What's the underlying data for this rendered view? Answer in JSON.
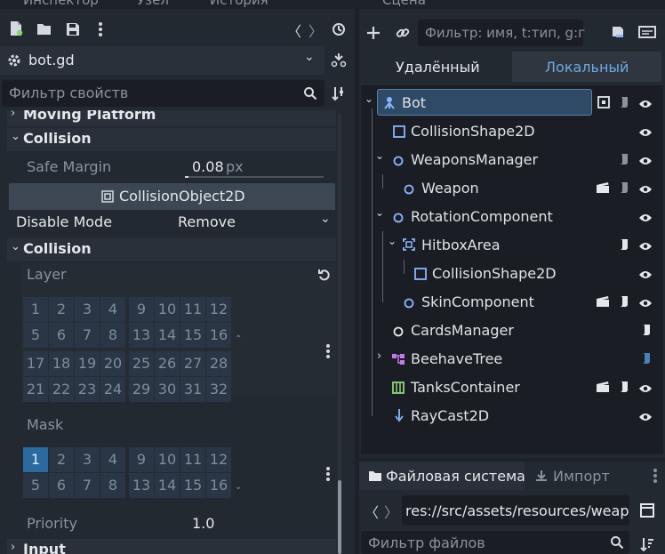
{
  "inspector": {
    "tabs": [
      "Инспектор",
      "Узел",
      "История"
    ],
    "script_name": "bot.gd",
    "filter_placeholder": "Фильтр свойств",
    "sections": {
      "moving_platform": "Moving Platform",
      "collision": "Collision",
      "safe_margin_label": "Safe Margin",
      "safe_margin_value": "0.08",
      "safe_margin_unit": "px",
      "class_header": "CollisionObject2D",
      "disable_mode_label": "Disable Mode",
      "disable_mode_value": "Remove",
      "collision_sub": "Collision",
      "layer_label": "Layer",
      "mask_label": "Mask",
      "priority_label": "Priority",
      "priority_value": "1.0",
      "input": "Input"
    },
    "layer_bits": [
      [
        "1",
        "2",
        "3",
        "4",
        "9",
        "10",
        "11",
        "12"
      ],
      [
        "5",
        "6",
        "7",
        "8",
        "13",
        "14",
        "15",
        "16"
      ],
      [
        "17",
        "18",
        "19",
        "20",
        "25",
        "26",
        "27",
        "28"
      ],
      [
        "21",
        "22",
        "23",
        "24",
        "29",
        "30",
        "31",
        "32"
      ]
    ],
    "mask_bits": [
      [
        "1",
        "2",
        "3",
        "4",
        "9",
        "10",
        "11",
        "12"
      ],
      [
        "5",
        "6",
        "7",
        "8",
        "13",
        "14",
        "15",
        "16"
      ]
    ],
    "mask_active": "1"
  },
  "scene": {
    "tab": "Сцена",
    "filter_placeholder": "Фильтр: имя, t:тип, g:г",
    "remote": "Удалённый",
    "local": "Локальный",
    "nodes": [
      {
        "name": "Bot",
        "icon": "bot-icon"
      },
      {
        "name": "CollisionShape2D",
        "icon": "collision-shape-icon"
      },
      {
        "name": "WeaponsManager",
        "icon": "node-circle-icon"
      },
      {
        "name": "Weapon",
        "icon": "node-circle-icon"
      },
      {
        "name": "RotationComponent",
        "icon": "node-circle-icon"
      },
      {
        "name": "HitboxArea",
        "icon": "area-icon"
      },
      {
        "name": "CollisionShape2D",
        "icon": "collision-shape-icon"
      },
      {
        "name": "SkinComponent",
        "icon": "node-circle-icon"
      },
      {
        "name": "CardsManager",
        "icon": "node-circle-icon"
      },
      {
        "name": "BeehaveTree",
        "icon": "behaviour-tree-icon"
      },
      {
        "name": "TanksContainer",
        "icon": "container-icon"
      },
      {
        "name": "RayCast2D",
        "icon": "raycast-icon"
      }
    ]
  },
  "filesystem": {
    "tab": "Файловая система",
    "import_tab": "Импорт",
    "path": "res://src/assets/resources/weap",
    "filter_placeholder": "Фильтр файлов"
  },
  "colors": {
    "accent": "#6ea8e0",
    "active_bit": "#2a6a9e",
    "node_blue": "#8db3ff",
    "ok_green": "#8bd47a"
  }
}
